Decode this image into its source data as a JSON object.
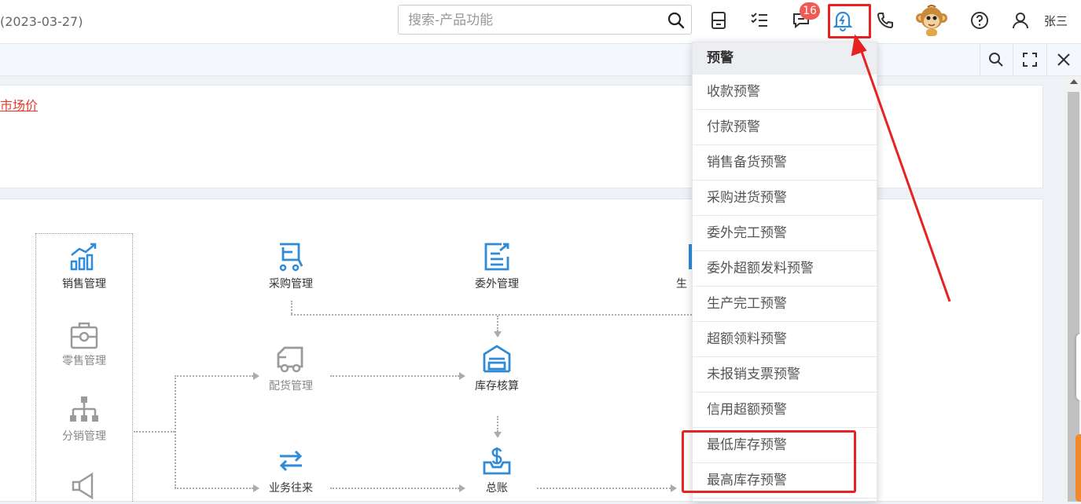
{
  "topbar": {
    "date_text": "(2023-03-27)",
    "search_placeholder": "搜索-产品功能",
    "notification_badge": "16",
    "username": "张三"
  },
  "notice": {
    "link_text": "市场价"
  },
  "modules": {
    "sales": "销售管理",
    "retail": "零售管理",
    "distribution": "分销管理",
    "purchase": "采购管理",
    "outsourcing": "委外管理",
    "production_partial": "生",
    "allocation": "配货管理",
    "inventory": "库存核算",
    "business": "业务往来",
    "ledger": "总账"
  },
  "dropdown": {
    "header": "预警",
    "items": [
      "收款预警",
      "付款预警",
      "销售备货预警",
      "采购进货预警",
      "委外完工预警",
      "委外超额发料预警",
      "生产完工预警",
      "超额领料预警",
      "未报销支票预警",
      "信用超额预警",
      "最低库存预警",
      "最高库存预警"
    ]
  },
  "colors": {
    "accent_blue": "#2f8ad8",
    "highlight_red": "#e62222",
    "badge_red": "#f05a52"
  }
}
